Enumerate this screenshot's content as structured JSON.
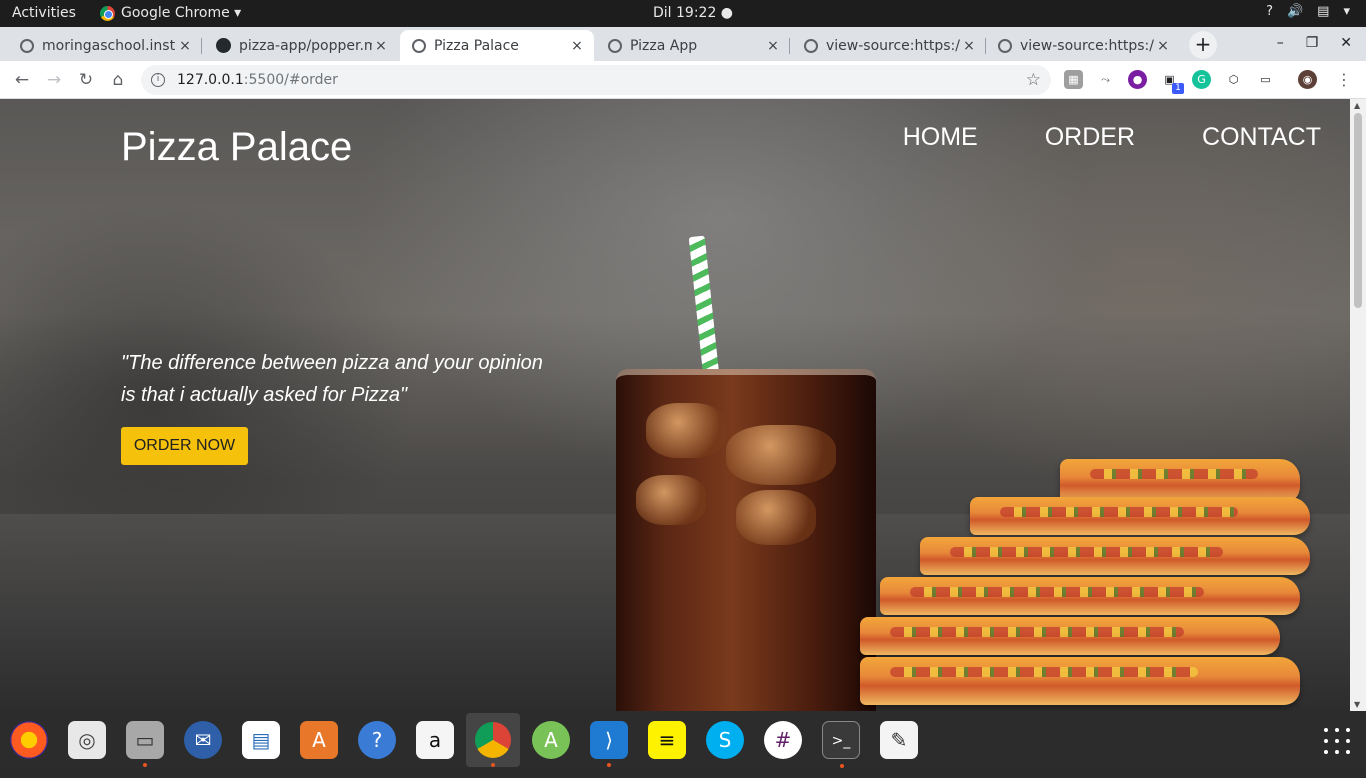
{
  "system_bar": {
    "activities": "Activities",
    "app_name": "Google Chrome ▾",
    "clock": "Dil 19:22 ●",
    "tray_help": "?",
    "tray_volume": "🔊",
    "tray_menu": "▾"
  },
  "browser": {
    "tabs": [
      {
        "label": "moringaschool.inst",
        "icon": "globe-icon"
      },
      {
        "label": "pizza-app/popper.m",
        "icon": "github-icon"
      },
      {
        "label": "Pizza Palace",
        "icon": "globe-icon",
        "active": true
      },
      {
        "label": "Pizza App",
        "icon": "globe-icon"
      },
      {
        "label": "view-source:https:/",
        "icon": "globe-icon"
      },
      {
        "label": "view-source:https:/",
        "icon": "globe-icon"
      }
    ],
    "close_glyph": "×",
    "new_tab_glyph": "+",
    "url_host": "127.0.0.1",
    "url_path": ":5500/#order",
    "info_glyph": "i",
    "star_glyph": "☆",
    "extension_badge": "1",
    "window_controls": {
      "minimize": "–",
      "restore": "❐",
      "close": "✕"
    }
  },
  "page": {
    "brand": "Pizza Palace",
    "nav": [
      "HOME",
      "ORDER",
      "CONTACT"
    ],
    "quote_line1": "\"The difference between pizza and your opinion",
    "quote_line2": "is that i actually asked for Pizza\"",
    "cta": "ORDER NOW"
  },
  "dock": {
    "apps": [
      "firefox-icon",
      "rhythmbox-icon",
      "files-icon",
      "thunderbird-icon",
      "writer-icon",
      "software-center-icon",
      "help-icon",
      "amazon-icon",
      "chrome-icon",
      "android-studio-icon",
      "vscode-icon",
      "notes-icon",
      "skype-icon",
      "slack-icon",
      "terminal-icon",
      "text-editor-icon"
    ]
  },
  "colors": {
    "accent_button": "#f5c10a",
    "top_bar": "#1d1d1d",
    "ubuntu_running_dot": "#e95420"
  }
}
